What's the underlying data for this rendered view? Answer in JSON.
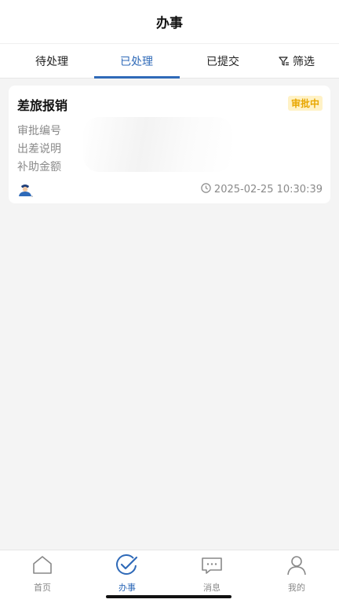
{
  "header": {
    "title": "办事"
  },
  "tabs": [
    {
      "label": "待处理",
      "active": false
    },
    {
      "label": "已处理",
      "active": true
    },
    {
      "label": "已提交",
      "active": false
    },
    {
      "label": "筛选",
      "icon": "filter-icon",
      "active": false
    }
  ],
  "card": {
    "title": "差旅报销",
    "status": "审批中",
    "fields": [
      "审批编号",
      "出差说明",
      "补助金额"
    ],
    "avatar_icon": "user-avatar-icon",
    "timestamp": "2025-02-25 10:30:39"
  },
  "bottom_nav": [
    {
      "label": "首页",
      "icon": "home-icon",
      "active": false
    },
    {
      "label": "办事",
      "icon": "check-circle-icon",
      "active": true
    },
    {
      "label": "消息",
      "icon": "message-icon",
      "active": false
    },
    {
      "label": "我的",
      "icon": "profile-icon",
      "active": false
    }
  ],
  "colors": {
    "accent": "#2f6ab8",
    "badge_bg": "#fff2c6",
    "badge_text": "#e8a700"
  }
}
